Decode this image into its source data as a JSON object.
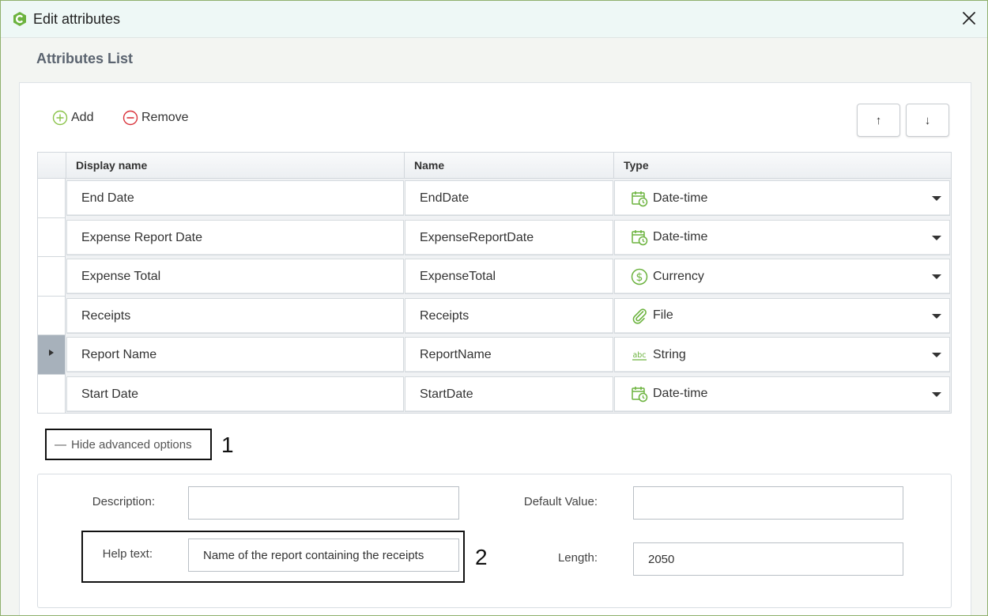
{
  "window": {
    "title": "Edit attributes",
    "accent_color": "#6cb33f"
  },
  "section": {
    "title": "Attributes List"
  },
  "toolbar": {
    "add_label": "Add",
    "remove_label": "Remove",
    "up_glyph": "↑",
    "down_glyph": "↓"
  },
  "grid": {
    "columns": [
      "Display name",
      "Name",
      "Type"
    ],
    "rows": [
      {
        "display": "End Date",
        "name": "EndDate",
        "type": "Date-time",
        "icon": "calendar-clock-icon",
        "selected": false
      },
      {
        "display": "Expense Report Date",
        "name": "ExpenseReportDate",
        "type": "Date-time",
        "icon": "calendar-clock-icon",
        "selected": false
      },
      {
        "display": "Expense Total",
        "name": "ExpenseTotal",
        "type": "Currency",
        "icon": "dollar-icon",
        "selected": false
      },
      {
        "display": "Receipts",
        "name": "Receipts",
        "type": "File",
        "icon": "paperclip-icon",
        "selected": false
      },
      {
        "display": "Report Name",
        "name": "ReportName",
        "type": "String",
        "icon": "abc-icon",
        "selected": true
      },
      {
        "display": "Start Date",
        "name": "StartDate",
        "type": "Date-time",
        "icon": "calendar-clock-icon",
        "selected": false
      }
    ]
  },
  "advanced": {
    "toggle_label": "Hide advanced options",
    "toggle_glyph": "—",
    "description_label": "Description:",
    "description_value": "",
    "default_value_label": "Default Value:",
    "default_value_value": "",
    "help_text_label": "Help text:",
    "help_text_value": "Name of the report containing the receipts",
    "length_label": "Length:",
    "length_value": "2050"
  },
  "callouts": {
    "one": "1",
    "two": "2"
  }
}
